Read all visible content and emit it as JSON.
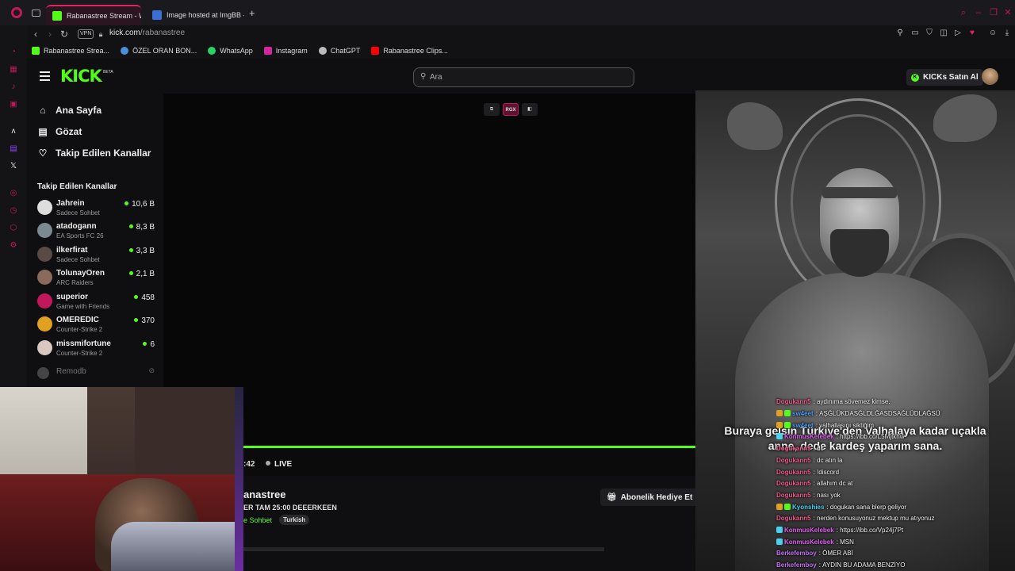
{
  "browser": {
    "tabs": [
      {
        "title": "Rabanastree Stream - Wa",
        "active": true,
        "favicon_color": "#53fc18"
      },
      {
        "title": "Image hosted at ImgBB —",
        "active": false,
        "favicon_color": "#3b6fd6"
      }
    ],
    "new_tab_label": "+",
    "vpn_label": "VPN",
    "url_domain": "kick.com",
    "url_path": "/rabanastree",
    "bookmarks": [
      {
        "label": "Rabanastree Strea...",
        "icon": "kick-icon",
        "color": "#53fc18"
      },
      {
        "label": "ÖZEL ORAN BON...",
        "icon": "globe-icon",
        "color": "#4a90d9"
      },
      {
        "label": "WhatsApp",
        "icon": "whatsapp-icon",
        "color": "#25d366"
      },
      {
        "label": "Instagram",
        "icon": "instagram-icon",
        "color": "#d6249f"
      },
      {
        "label": "ChatGPT",
        "icon": "chatgpt-icon",
        "color": "#bbbbbb"
      },
      {
        "label": "Rabanastree Clips...",
        "icon": "youtube-icon",
        "color": "#ff0000"
      }
    ]
  },
  "kick": {
    "logo": "KICK",
    "logo_badge": "BETA",
    "search_placeholder": "Ara",
    "kicks_button": "KICKs Satın Al",
    "nav": [
      {
        "label": "Ana Sayfa",
        "icon": "home-icon"
      },
      {
        "label": "Gözat",
        "icon": "browse-icon"
      },
      {
        "label": "Takip Edilen Kanallar",
        "icon": "heart-icon"
      }
    ],
    "followed_title": "Takip Edilen Kanallar",
    "channels": [
      {
        "name": "Jahrein",
        "category": "Sadece Sohbet",
        "viewers": "10,6 B",
        "avatar_color": "#dddddd"
      },
      {
        "name": "atadogann",
        "category": "EA Sports FC 26",
        "viewers": "8,3 B",
        "avatar_color": "#7a8a90"
      },
      {
        "name": "ilkerfirat",
        "category": "Sadece Sohbet",
        "viewers": "3,3 B",
        "avatar_color": "#5a4a44"
      },
      {
        "name": "TolunayOren",
        "category": "ARC Raiders",
        "viewers": "2,1 B",
        "avatar_color": "#8a6a5a"
      },
      {
        "name": "superior",
        "category": "Game with Friends",
        "viewers": "458",
        "avatar_color": "#c2185b"
      },
      {
        "name": "OMEREDIC",
        "category": "Counter-Strike 2",
        "viewers": "370",
        "avatar_color": "#e0a020"
      },
      {
        "name": "missmifortune",
        "category": "Counter-Strike 2",
        "viewers": "6",
        "avatar_color": "#d8c8c0"
      }
    ],
    "offline_channel": "Remodb"
  },
  "player": {
    "controls": [
      "popout-icon",
      "RGX",
      "theatre-icon"
    ],
    "time": ":42",
    "live_label": "LIVE",
    "progress_fraction": 1.0
  },
  "stream": {
    "streamer": "anastree",
    "title": "ER TAM 25:00 DEEERKEEN",
    "category": "e Sohbet",
    "tag": "Turkish",
    "gift_button": "Abonelik Hediye Et"
  },
  "overlay": {
    "subtitle_line1": "Buraya gelsin Türkiye'den Valhalaya kadar uçakla",
    "subtitle_line2": "anne, dede kardeş yaparım sana."
  },
  "chat": [
    {
      "user": "Dogukann5",
      "text": "aydınıma sövemez kimse.",
      "color": "#f05a8c",
      "badge": "none"
    },
    {
      "user": "sw4eet",
      "text": "AŞĞLÜKDASĞLDLĞASDSAĞLÜDLAĞSÜ",
      "color": "#4a9cf0",
      "badge": "sub"
    },
    {
      "user": "sw4eet",
      "text": "valhallasını siktiğim",
      "color": "#4a9cf0",
      "badge": "sub"
    },
    {
      "user": "KonmusKelebek",
      "text": "https://ibb.co/L5Mjtkhw",
      "color": "#e060f0",
      "badge": "vip"
    },
    {
      "user": "Dogukann5",
      "text": "dc",
      "color": "#f05a8c",
      "badge": "none"
    },
    {
      "user": "Dogukann5",
      "text": "dc atın la",
      "color": "#f05a8c",
      "badge": "none"
    },
    {
      "user": "Dogukann5",
      "text": "!discord",
      "color": "#f05a8c",
      "badge": "none"
    },
    {
      "user": "Dogukann5",
      "text": "allahım dc at",
      "color": "#f05a8c",
      "badge": "none"
    },
    {
      "user": "Dogukann5",
      "text": "nası yok",
      "color": "#f05a8c",
      "badge": "none"
    },
    {
      "user": "Kyonshies",
      "text": "dogukan sana blerp geliyor",
      "color": "#4ad0f0",
      "badge": "sub"
    },
    {
      "user": "Dogukann5",
      "text": "nerden konusuyonuz mektup mu atıyonuz",
      "color": "#f05a8c",
      "badge": "none"
    },
    {
      "user": "KonmusKelebek",
      "text": "https://ibb.co/Vp24j7Pt",
      "color": "#e060f0",
      "badge": "vip"
    },
    {
      "user": "KonmusKelebek",
      "text": "MSN",
      "color": "#e060f0",
      "badge": "vip"
    },
    {
      "user": "Berkefemboy",
      "text": "ÖMER ABİ",
      "color": "#c070f0",
      "badge": "none"
    },
    {
      "user": "Berkefemboy",
      "text": "AYDIN BU ADAMA BENZİYO",
      "color": "#c070f0",
      "badge": "none"
    }
  ]
}
